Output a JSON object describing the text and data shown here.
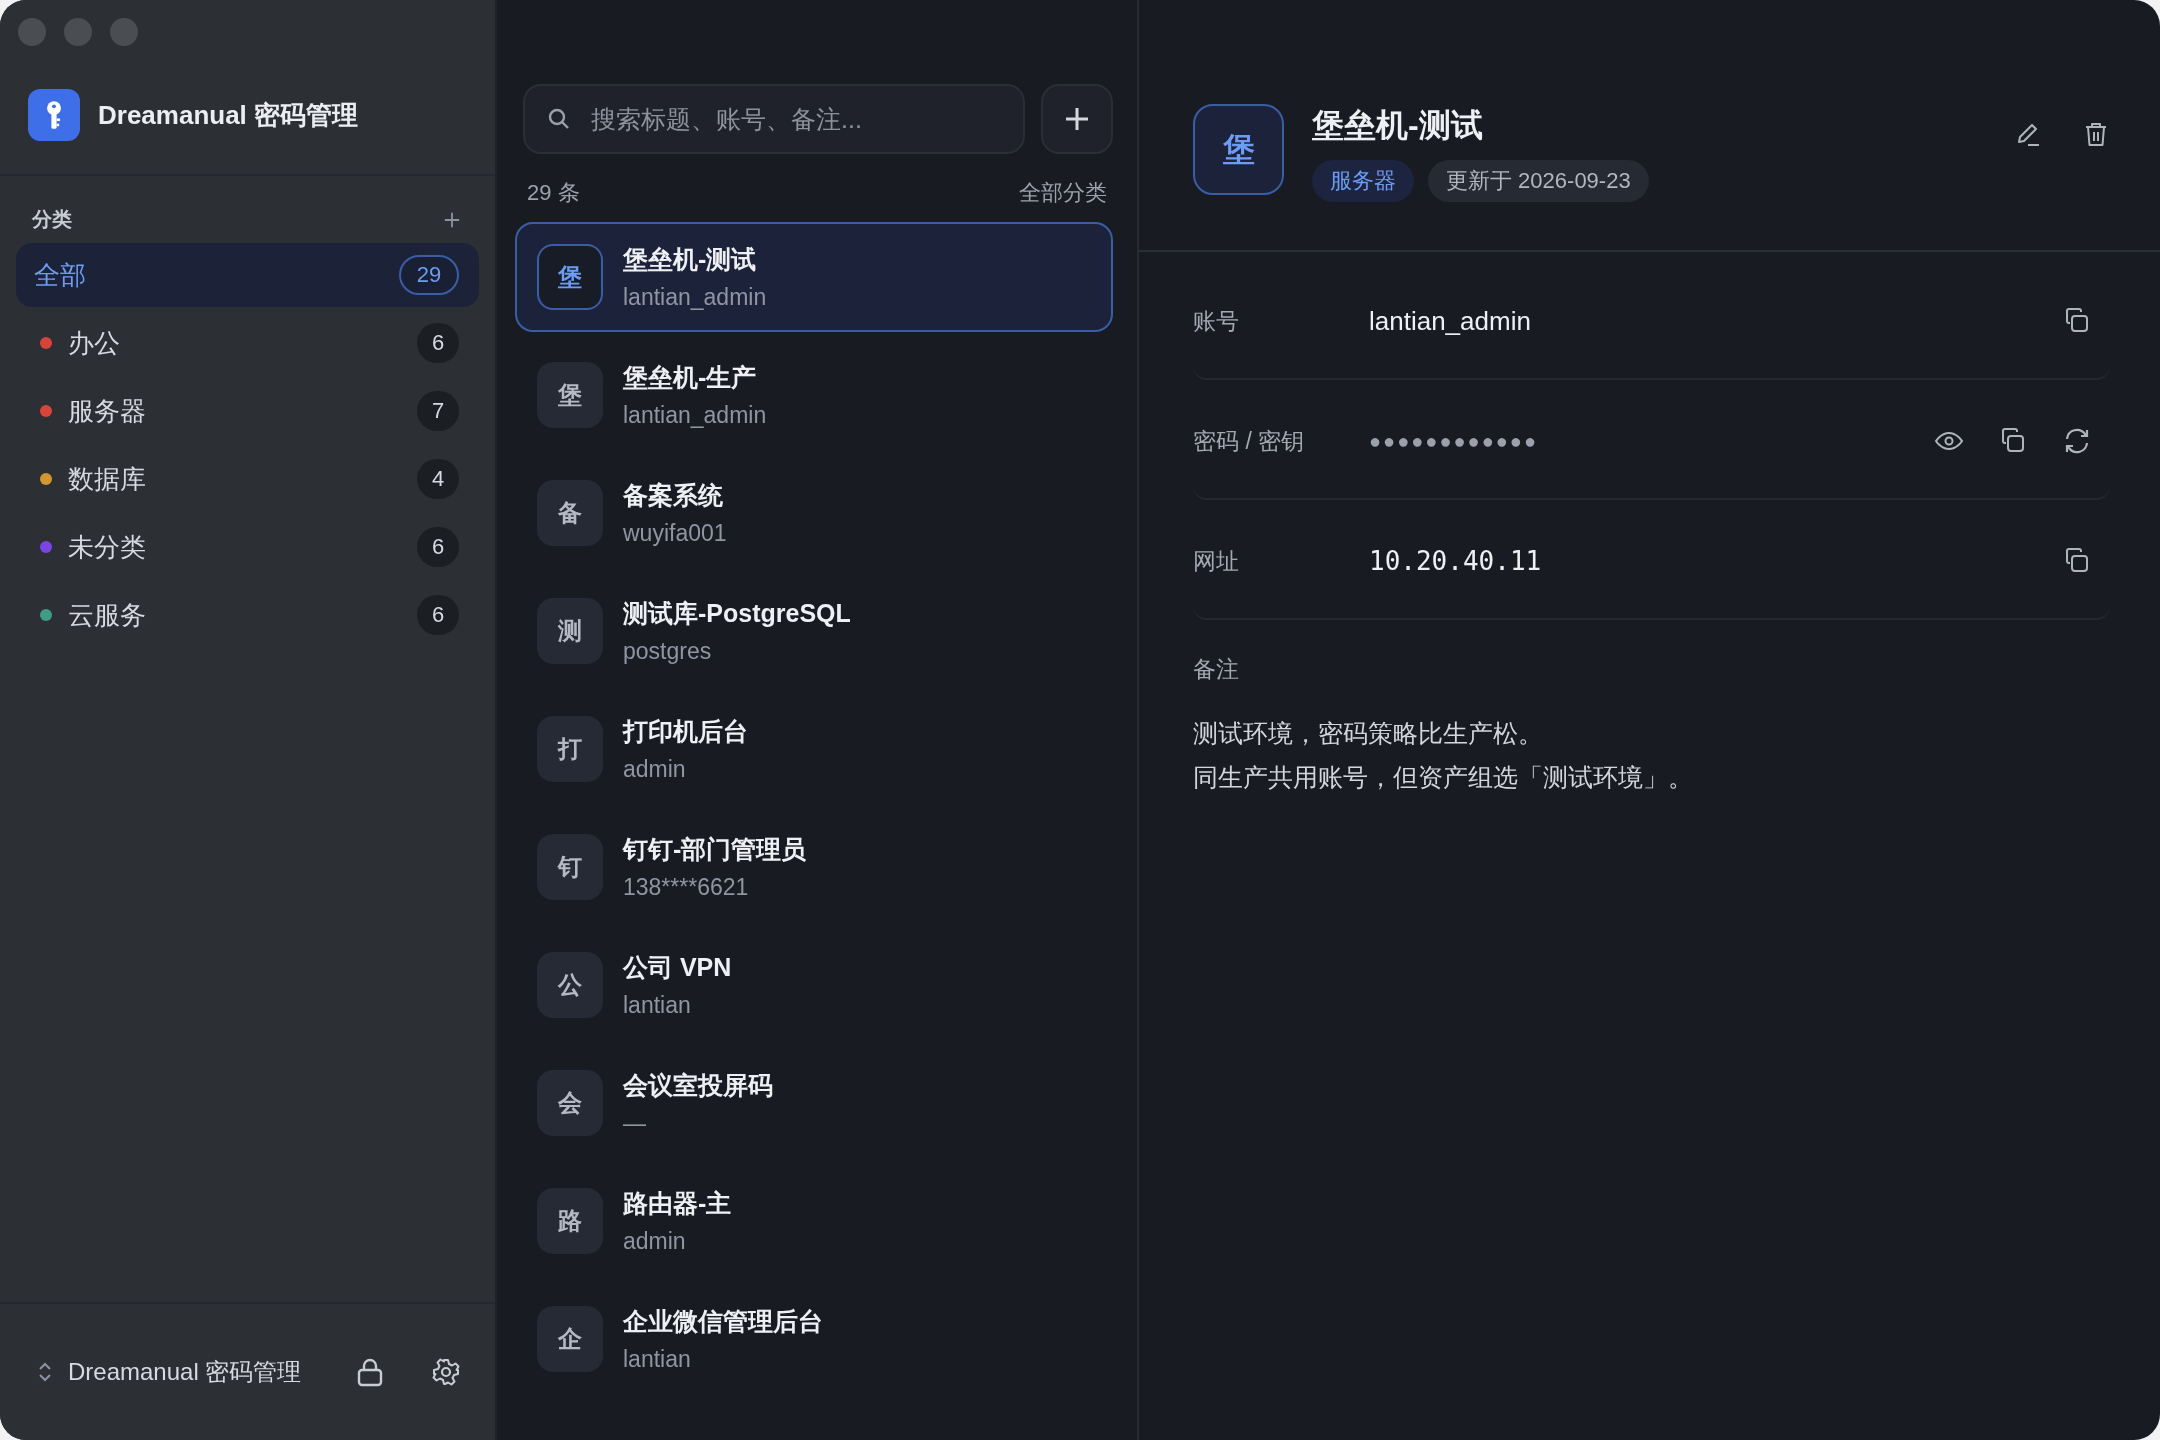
{
  "app": {
    "name": "Dreamanual 密码管理"
  },
  "sidebar": {
    "section_title": "分类",
    "categories": [
      {
        "name": "全部",
        "count": "29",
        "selected": true
      },
      {
        "name": "办公",
        "count": "6",
        "color": "#d9443a",
        "selected": false
      },
      {
        "name": "服务器",
        "count": "7",
        "color": "#d9443a",
        "selected": false
      },
      {
        "name": "数据库",
        "count": "4",
        "color": "#d4962e",
        "selected": false
      },
      {
        "name": "未分类",
        "count": "6",
        "color": "#7b45e6",
        "selected": false
      },
      {
        "name": "云服务",
        "count": "6",
        "color": "#3f9d86",
        "selected": false
      }
    ],
    "footer": {
      "vault": "Dreamanual 密码管理"
    }
  },
  "list": {
    "search": {
      "placeholder": "搜索标题、账号、备注..."
    },
    "count": "29 条",
    "filter": "全部分类",
    "items": [
      {
        "avatar": "堡",
        "title": "堡垒机-测试",
        "account": "lantian_admin",
        "selected": true
      },
      {
        "avatar": "堡",
        "title": "堡垒机-生产",
        "account": "lantian_admin",
        "selected": false
      },
      {
        "avatar": "备",
        "title": "备案系统",
        "account": "wuyifa001",
        "selected": false
      },
      {
        "avatar": "测",
        "title": "测试库-PostgreSQL",
        "account": "postgres",
        "selected": false
      },
      {
        "avatar": "打",
        "title": "打印机后台",
        "account": "admin",
        "selected": false
      },
      {
        "avatar": "钉",
        "title": "钉钉-部门管理员",
        "account": "138****6621",
        "selected": false
      },
      {
        "avatar": "公",
        "title": "公司 VPN",
        "account": "lantian",
        "selected": false
      },
      {
        "avatar": "会",
        "title": "会议室投屏码",
        "account": "—",
        "selected": false
      },
      {
        "avatar": "路",
        "title": "路由器-主",
        "account": "admin",
        "selected": false
      },
      {
        "avatar": "企",
        "title": "企业微信管理后台",
        "account": "lantian",
        "selected": false
      }
    ]
  },
  "detail": {
    "avatar": "堡",
    "title": "堡垒机-测试",
    "tags": [
      {
        "text": "服务器",
        "kind": "category"
      },
      {
        "text": "更新于 2026-09-23",
        "kind": "date"
      }
    ],
    "fields": [
      {
        "label": "账号",
        "value": "lantian_admin",
        "kind": "text"
      },
      {
        "label": "密码 / 密钥",
        "value": "●●●●●●●●●●●●",
        "kind": "secret"
      },
      {
        "label": "网址",
        "value": "10.20.40.11",
        "kind": "url"
      }
    ],
    "notes": {
      "label": "备注",
      "lines": [
        "测试环境，密码策略比生产松。",
        "同生产共用账号，但资产组选「测试环境」。"
      ]
    }
  }
}
